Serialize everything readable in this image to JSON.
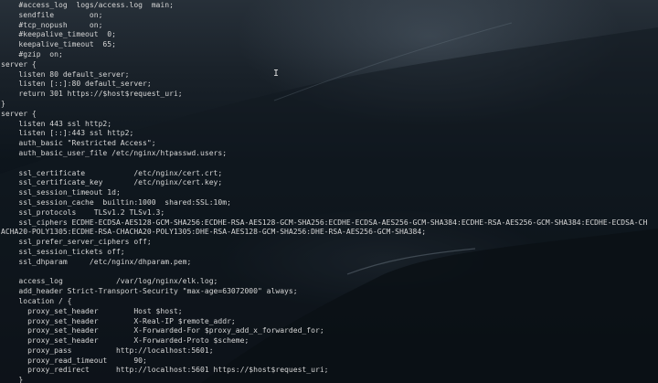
{
  "terminal": {
    "lines": [
      "    #access_log  logs/access.log  main;",
      "    sendfile        on;",
      "    #tcp_nopush     on;",
      "    #keepalive_timeout  0;",
      "    keepalive_timeout  65;",
      "    #gzip  on;",
      "server {",
      "    listen 80 default_server;",
      "    listen [::]:80 default_server;",
      "    return 301 https://$host$request_uri;",
      "}",
      "server {",
      "    listen 443 ssl http2;",
      "    listen [::]:443 ssl http2;",
      "    auth_basic \"Restricted Access\";",
      "    auth_basic_user_file /etc/nginx/htpasswd.users;",
      "",
      "    ssl_certificate           /etc/nginx/cert.crt;",
      "    ssl_certificate_key       /etc/nginx/cert.key;",
      "    ssl_session_timeout 1d;",
      "    ssl_session_cache  builtin:1000  shared:SSL:10m;",
      "    ssl_protocols    TLSv1.2 TLSv1.3;",
      "    ssl_ciphers ECDHE-ECDSA-AES128-GCM-SHA256:ECDHE-RSA-AES128-GCM-SHA256:ECDHE-ECDSA-AES256-GCM-SHA384:ECDHE-RSA-AES256-GCM-SHA384:ECDHE-ECDSA-CH",
      "ACHA20-POLY1305:ECDHE-RSA-CHACHA20-POLY1305:DHE-RSA-AES128-GCM-SHA256:DHE-RSA-AES256-GCM-SHA384;",
      "    ssl_prefer_server_ciphers off;",
      "    ssl_session_tickets off;",
      "    ssl_dhparam     /etc/nginx/dhparam.pem;",
      "",
      "    access_log            /var/log/nginx/elk.log;",
      "    add_header Strict-Transport-Security \"max-age=63072000\" always;",
      "    location / {",
      "      proxy_set_header        Host $host;",
      "      proxy_set_header        X-Real-IP $remote_addr;",
      "      proxy_set_header        X-Forwarded-For $proxy_add_x_forwarded_for;",
      "      proxy_set_header        X-Forwarded-Proto $scheme;",
      "      proxy_pass          http://localhost:5601;",
      "      proxy_read_timeout      90;",
      "      proxy_redirect      http://localhost:5601 https://$host$request_uri;",
      "    }",
      "  }"
    ],
    "cursor_glyph": "I"
  },
  "colors": {
    "text": "#d6d6d6",
    "background_top": "#273039",
    "background_bottom": "#070b10"
  }
}
